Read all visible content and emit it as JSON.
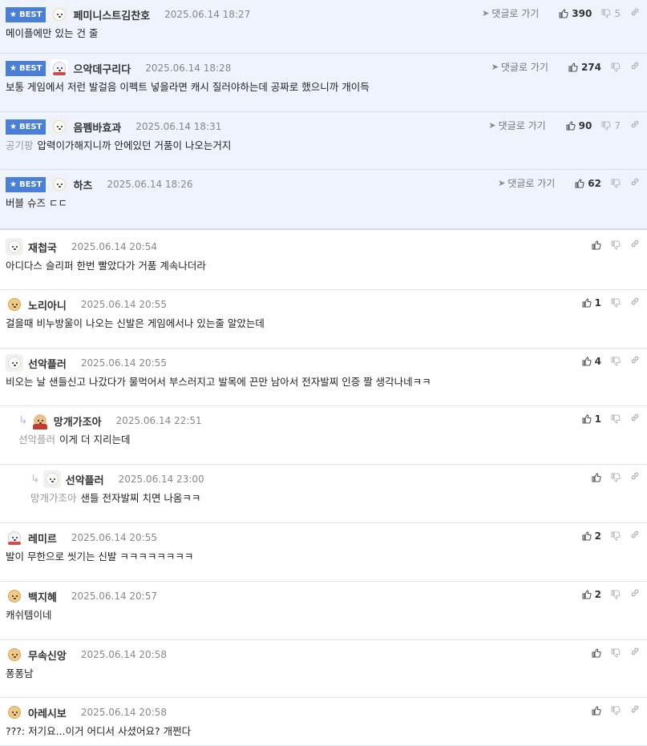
{
  "best_label": "BEST",
  "goto_label": "댓글로 가기",
  "comments": [
    {
      "nick": "페미니스트김찬호",
      "date": "2025.06.14 18:27",
      "body": "메이플에만 있는 건 줄",
      "mention": "",
      "up": "390",
      "down": "5",
      "best": true,
      "avatar": "white-dog"
    },
    {
      "nick": "으악데구리다",
      "date": "2025.06.14 18:28",
      "body": "보통 게임에서 저런 발걸음 이펙트 넣을라면 캐시 질러야하는데 공짜로 했으니까 개이득",
      "mention": "",
      "up": "274",
      "down": "",
      "best": true,
      "avatar": "polar-bear"
    },
    {
      "nick": "음펨바효과",
      "date": "2025.06.14 18:31",
      "body": "압력이가해지니까 안에있던 거품이 나오는거지",
      "mention": "공기팡",
      "up": "90",
      "down": "7",
      "best": true,
      "avatar": "white-dog"
    },
    {
      "nick": "하츠",
      "date": "2025.06.14 18:26",
      "body": "버블 슈즈 ㄷㄷ",
      "mention": "",
      "up": "62",
      "down": "",
      "best": true,
      "avatar": "white-dog"
    },
    {
      "nick": "재첩국",
      "date": "2025.06.14 20:54",
      "body": "아디다스 슬리퍼 한번 빨았다가 거품 계속나더라",
      "mention": "",
      "up": "",
      "down": "",
      "best": false,
      "avatar": "white-dog"
    },
    {
      "nick": "노리아니",
      "date": "2025.06.14 20:55",
      "body": "걸을때 비누방울이 나오는 신발은 게임에서나 있는줄 알았는데",
      "mention": "",
      "up": "1",
      "down": "",
      "best": false,
      "avatar": "puppy"
    },
    {
      "nick": "선악플러",
      "date": "2025.06.14 20:55",
      "body": "비오는 날 샌들신고 나갔다가 물먹어서 부스러지고 발목에 끈만 남아서 전자발찌 인증 짤 생각나네ㅋㅋ",
      "mention": "",
      "up": "4",
      "down": "",
      "best": false,
      "avatar": "white-dog"
    },
    {
      "nick": "망개가조아",
      "date": "2025.06.14 22:51",
      "body": "이게 더 지리는데",
      "mention": "선악플러",
      "up": "1",
      "down": "",
      "best": false,
      "avatar": "red-cape",
      "reply": 1
    },
    {
      "nick": "선악플러",
      "date": "2025.06.14 23:00",
      "body": "샌들 전자발찌 치면 나옴ㅋㅋ",
      "mention": "망개가조아",
      "up": "",
      "down": "",
      "best": false,
      "avatar": "white-dog",
      "reply": 2
    },
    {
      "nick": "레미르",
      "date": "2025.06.14 20:55",
      "body": "발이 무한으로 씻기는 신발 ㅋㅋㅋㅋㅋㅋㅋㅋ",
      "mention": "",
      "up": "2",
      "down": "",
      "best": false,
      "avatar": "polar-bear"
    },
    {
      "nick": "백지혜",
      "date": "2025.06.14 20:57",
      "body": "캐쉬템이네",
      "mention": "",
      "up": "2",
      "down": "",
      "best": false,
      "avatar": "puppy"
    },
    {
      "nick": "무속신앙",
      "date": "2025.06.14 20:58",
      "body": "퐁퐁남",
      "mention": "",
      "up": "",
      "down": "",
      "best": false,
      "avatar": "puppy"
    },
    {
      "nick": "아레시보",
      "date": "2025.06.14 20:58",
      "body": "???: 저기요...이거 어디서 사셨어요? 개쩐다",
      "mention": "",
      "up": "",
      "down": "",
      "best": false,
      "avatar": "puppy"
    }
  ]
}
